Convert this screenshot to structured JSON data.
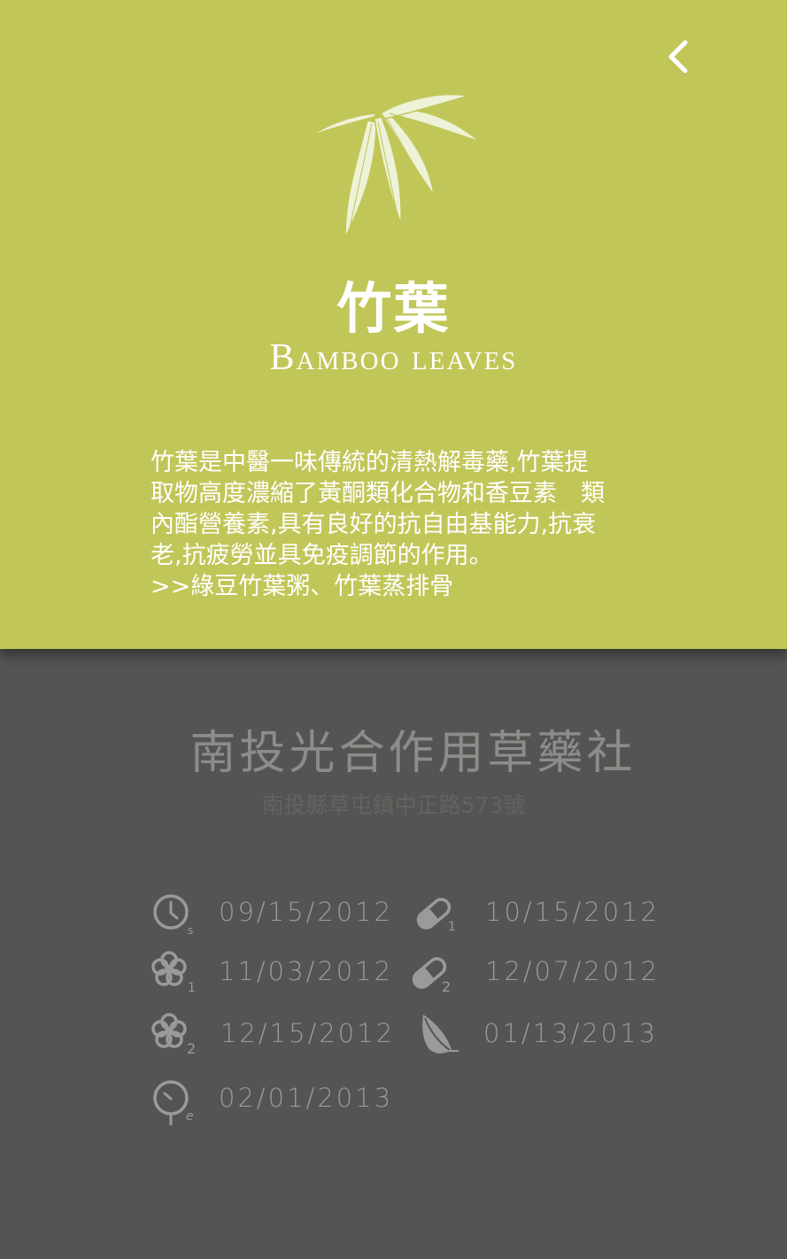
{
  "header": {
    "back_icon": "chevron-left-icon",
    "illustration_icon": "bamboo-leaves-icon",
    "title": "竹葉",
    "subtitle": "Bamboo leaves",
    "description_lines": [
      "竹葉是中醫一味傳統的清熱解毒藥,竹葉提",
      "取物高度濃縮了黃酮類化合物和香豆素　類",
      "內酯營養素,具有良好的抗自由基能力,抗衰",
      "老,抗疲勞並具免疫調節的作用。",
      ">>綠豆竹葉粥、竹葉蒸排骨"
    ]
  },
  "shop": {
    "name": "南投光合作用草藥社",
    "address": "南投縣草屯鎮中正路573號"
  },
  "timeline": [
    {
      "icon": "clock-start-icon",
      "date": "09/15/2012"
    },
    {
      "icon": "pill-1-icon",
      "date": "10/15/2012"
    },
    {
      "icon": "flower-1-icon",
      "date": "11/03/2012"
    },
    {
      "icon": "pill-2-icon",
      "date": "12/07/2012"
    },
    {
      "icon": "flower-2-icon",
      "date": "12/15/2012"
    },
    {
      "icon": "leaf-icon",
      "date": "01/13/2013"
    },
    {
      "icon": "clock-end-icon",
      "date": "02/01/2013"
    }
  ],
  "colors": {
    "top_background": "#c1c658",
    "bottom_background": "#545452",
    "text_light": "#ffffff",
    "text_muted": "#9a9a98"
  }
}
